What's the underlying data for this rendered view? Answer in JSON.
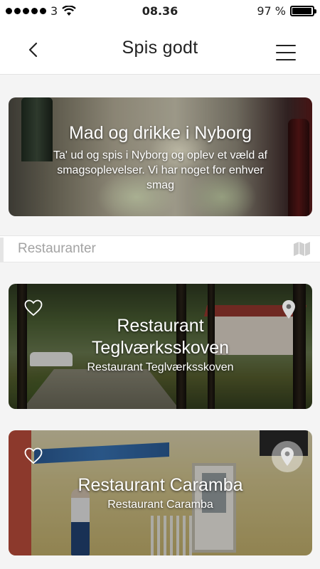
{
  "status_bar": {
    "carrier": "3",
    "time": "08.36",
    "battery_text": "97 %",
    "battery_level": 0.97
  },
  "nav": {
    "title": "Spis godt",
    "back_icon": "chevron-left-icon",
    "menu_icon": "hamburger-menu-icon"
  },
  "hero": {
    "title": "Mad og drikke i Nyborg",
    "description": "Ta' ud og spis i Nyborg og oplev et væld af smagsoplevelser. Vi har noget for enhver smag"
  },
  "section": {
    "title": "Restauranter",
    "icon": "map-icon"
  },
  "restaurants": [
    {
      "name": "Restaurant Teglværksskoven",
      "subtitle": "Restaurant Teglværksskoven",
      "favorite_icon": "heart-icon",
      "location_icon": "map-pin-icon"
    },
    {
      "name": "Restaurant Caramba",
      "subtitle": "Restaurant Caramba",
      "favorite_icon": "heart-icon",
      "location_icon": "map-pin-icon"
    }
  ],
  "colors": {
    "background": "#f4f4f4",
    "header_bg": "#ffffff",
    "section_text": "#a3a3a3",
    "overlay_text": "#ffffff"
  }
}
